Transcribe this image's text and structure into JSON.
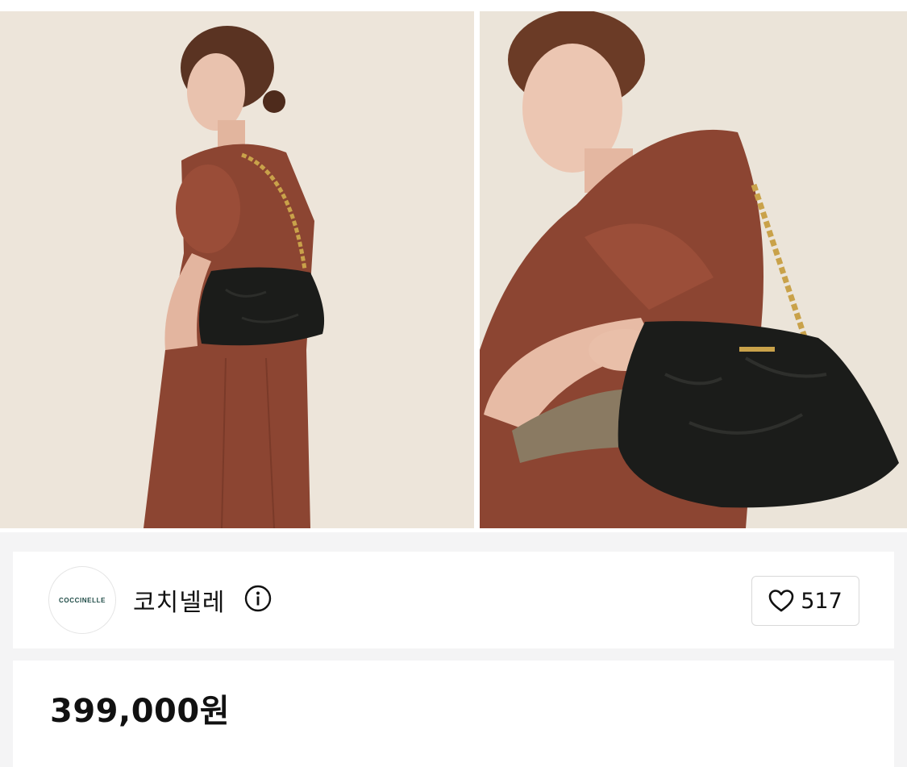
{
  "seller": {
    "logo_text": "COCCINELLE",
    "name": "코치넬레"
  },
  "likes": {
    "count": "517"
  },
  "product": {
    "price": "399,000원"
  },
  "gallery": {
    "images": [
      {
        "icon": "model-with-black-bag-photo"
      },
      {
        "icon": "model-with-black-bag-closeup-photo"
      }
    ]
  },
  "colors": {
    "dress": "#8c4532",
    "bag": "#1b1c1a",
    "chain": "#c9a24a",
    "backdrop": "#ece4d9"
  }
}
